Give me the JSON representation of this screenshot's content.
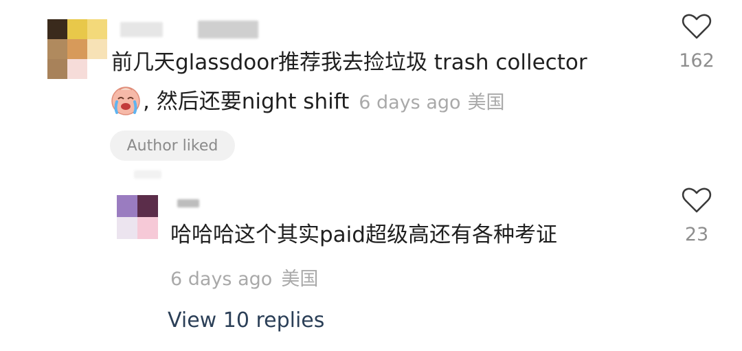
{
  "comment": {
    "text_line1": "前几天glassdoor推荐我去捡垃圾 trash collector",
    "text_line2": ", 然后还要night shift",
    "time": "6 days ago",
    "location": "美国",
    "badge": "Author liked",
    "like_count": "162",
    "emoji": "crying-face-icon"
  },
  "reply": {
    "text": "哈哈哈这个其实paid超级高还有各种考证",
    "time": "6 days ago",
    "location": "美国",
    "like_count": "23"
  },
  "view_replies_label": "View 10 replies",
  "colors": {
    "link": "#2b3f57",
    "meta": "#a9a9a9",
    "badge_bg": "#f1f1f1"
  }
}
